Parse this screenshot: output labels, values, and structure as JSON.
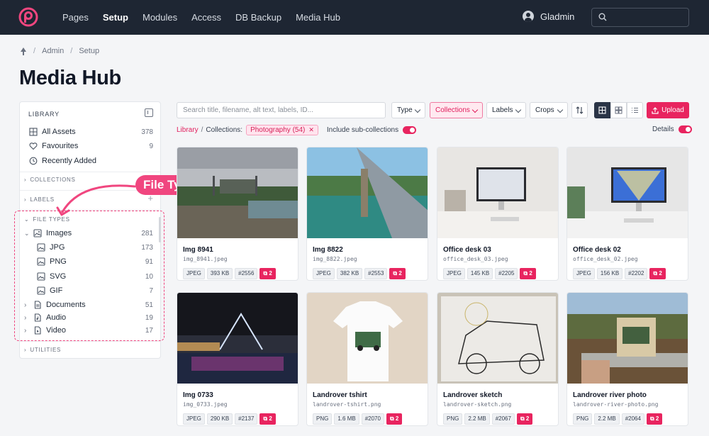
{
  "nav": {
    "items": [
      {
        "label": "Pages",
        "active": false
      },
      {
        "label": "Setup",
        "active": true
      },
      {
        "label": "Modules",
        "active": false
      },
      {
        "label": "Access",
        "active": false
      },
      {
        "label": "DB Backup",
        "active": false
      },
      {
        "label": "Media Hub",
        "active": false
      }
    ],
    "user": "Gladmin"
  },
  "breadcrumb": [
    "Admin",
    "Setup"
  ],
  "page_title": "Media Hub",
  "sidebar": {
    "heading": "LIBRARY",
    "items": [
      {
        "label": "All Assets",
        "count": "378",
        "icon": "grid-icon"
      },
      {
        "label": "Favourites",
        "count": "9",
        "icon": "heart-icon"
      },
      {
        "label": "Recently Added",
        "count": "",
        "icon": "clock-icon"
      }
    ],
    "sections": {
      "collections": "COLLECTIONS",
      "labels": "LABELS",
      "file_types": "FILE TYPES",
      "utilities": "UTILITIES"
    },
    "file_types": [
      {
        "label": "Images",
        "count": "281",
        "level": 0,
        "expanded": true
      },
      {
        "label": "JPG",
        "count": "173",
        "level": 1
      },
      {
        "label": "PNG",
        "count": "91",
        "level": 1
      },
      {
        "label": "SVG",
        "count": "10",
        "level": 1
      },
      {
        "label": "GIF",
        "count": "7",
        "level": 1
      },
      {
        "label": "Documents",
        "count": "51",
        "level": 0,
        "expanded": false
      },
      {
        "label": "Audio",
        "count": "19",
        "level": 0,
        "expanded": false
      },
      {
        "label": "Video",
        "count": "17",
        "level": 0,
        "expanded": false
      }
    ],
    "callout": "File Types"
  },
  "toolbar": {
    "search_placeholder": "Search title, filename, alt text, labels, ID...",
    "type": "Type",
    "collections": "Collections",
    "labels": "Labels",
    "crops": "Crops",
    "upload": "Upload"
  },
  "filters": {
    "library": "Library",
    "sep": "/",
    "collections": "Collections:",
    "chip": "Photography",
    "chip_count": "(54)",
    "include_sub": "Include sub-collections",
    "details": "Details"
  },
  "assets": [
    {
      "title": "Img 8941",
      "file": "img_8941.jpeg",
      "type": "JPEG",
      "size": "393 KB",
      "id": "#2556",
      "crops": "2"
    },
    {
      "title": "Img 8822",
      "file": "img_8822.jpeg",
      "type": "JPEG",
      "size": "382 KB",
      "id": "#2553",
      "crops": "2"
    },
    {
      "title": "Office desk 03",
      "file": "office_desk_03.jpeg",
      "type": "JPEG",
      "size": "145 KB",
      "id": "#2205",
      "crops": "2"
    },
    {
      "title": "Office desk 02",
      "file": "office_desk_02.jpeg",
      "type": "JPEG",
      "size": "156 KB",
      "id": "#2202",
      "crops": "2"
    },
    {
      "title": "Img 0733",
      "file": "img_0733.jpeg",
      "type": "JPEG",
      "size": "290 KB",
      "id": "#2137",
      "crops": "2"
    },
    {
      "title": "Landrover tshirt",
      "file": "landrover-tshirt.png",
      "type": "PNG",
      "size": "1.6 MB",
      "id": "#2070",
      "crops": "2"
    },
    {
      "title": "Landrover sketch",
      "file": "landrover-sketch.png",
      "type": "PNG",
      "size": "2.2 MB",
      "id": "#2067",
      "crops": "2"
    },
    {
      "title": "Landrover river photo",
      "file": "landrover-river-photo.png",
      "type": "PNG",
      "size": "2.2 MB",
      "id": "#2064",
      "crops": "2"
    }
  ],
  "colors": {
    "accent": "#e8245f",
    "nav_bg": "#1e2633"
  }
}
